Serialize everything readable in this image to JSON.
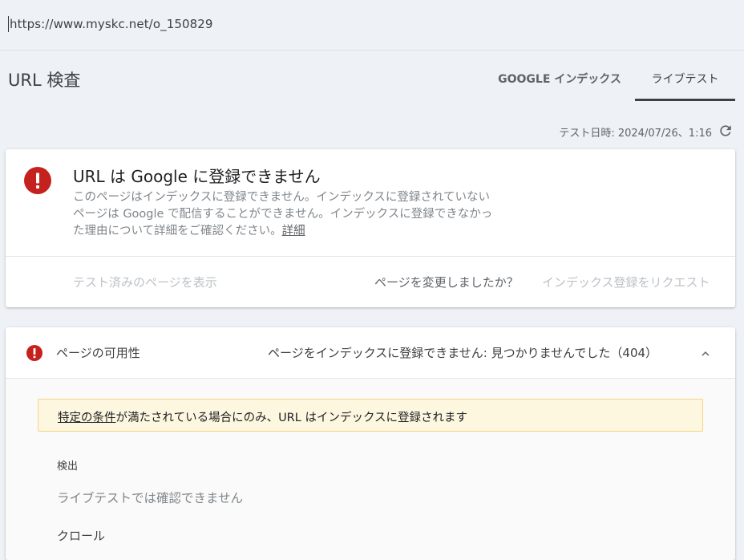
{
  "url_bar": {
    "value": "https://www.myskc.net/o_150829"
  },
  "header": {
    "title": "URL 検査",
    "tabs": [
      {
        "label": "GOOGLE インデックス",
        "active": false
      },
      {
        "label": "ライブテスト",
        "active": true
      }
    ]
  },
  "test_date": "テスト日時: 2024/07/26、1:16",
  "main_card": {
    "heading": "URL は Google に登録できません",
    "description_lines": [
      "このページはインデックスに登録できません。インデックスに登録されていない",
      "ページは Google で配信することができません。インデックスに登録できなかっ",
      "た理由について詳細をご確認ください。"
    ],
    "detail_link": "詳細",
    "buttons": {
      "view_tested": "テスト済みのページを表示",
      "page_changed": "ページを変更しましたか？",
      "request_indexing": "インデックス登録をリクエスト"
    }
  },
  "availability": {
    "label": "ページの可用性",
    "status": "ページをインデックスに登録できません: 見つかりませんでした（404）",
    "notice_link": "特定の条件",
    "notice_text": "が満たされている場合にのみ、URL はインデックスに登録されます",
    "sections": {
      "discovery_label": "検出",
      "discovery_value": "ライブテストでは確認できません",
      "crawl_label": "クロール"
    }
  },
  "colors": {
    "background": "#eef2f6",
    "error_red": "#c5221f",
    "notice_bg": "#fef7e0",
    "notice_border": "#f6d483",
    "disabled_text": "#bdc1c6"
  },
  "icons": [
    "error-icon",
    "refresh-icon",
    "chevron-up-icon"
  ]
}
